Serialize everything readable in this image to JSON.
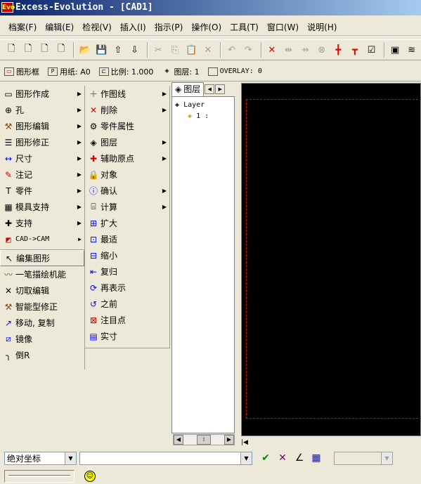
{
  "title": "Excess-Evolution - [CAD1]",
  "app_icon": "Evo",
  "menus": [
    "档案(F)",
    "编辑(E)",
    "检视(V)",
    "插入(I)",
    "指示(P)",
    "操作(O)",
    "工具(T)",
    "窗口(W)",
    "说明(H)"
  ],
  "status": {
    "frame": "图形框",
    "paper": "用纸: A0",
    "scale": "比例: 1.000",
    "layer": "图层: 1",
    "overlay": "OVERLAY: 0"
  },
  "left_menu": [
    {
      "label": "图形作成",
      "icon": "shape-icon",
      "arrow": true
    },
    {
      "label": "孔",
      "icon": "hole-icon",
      "arrow": true
    },
    {
      "label": "图形编辑",
      "icon": "hammer-icon",
      "arrow": true
    },
    {
      "label": "图形修正",
      "icon": "lines-icon",
      "arrow": true
    },
    {
      "label": "尺寸",
      "icon": "dimension-icon",
      "arrow": true
    },
    {
      "label": "注记",
      "icon": "annotation-icon",
      "arrow": true
    },
    {
      "label": "零件",
      "icon": "part-icon",
      "arrow": true
    },
    {
      "label": "模具支持",
      "icon": "mold-icon",
      "arrow": true
    },
    {
      "label": "支持",
      "icon": "cross-icon",
      "arrow": true
    },
    {
      "label": "CAD->CAM",
      "icon": "cam-icon",
      "arrow": true
    },
    {
      "label": "编集图形",
      "icon": "cursor-icon",
      "arrow": false
    },
    {
      "label": "一笔描绘机能",
      "icon": "stroke-icon",
      "arrow": false
    },
    {
      "label": "切取编辑",
      "icon": "cut-icon",
      "arrow": false
    },
    {
      "label": "智能型修正",
      "icon": "hammer-icon",
      "arrow": false
    },
    {
      "label": "移动, 复制",
      "icon": "move-icon",
      "arrow": false
    },
    {
      "label": "镜像",
      "icon": "mirror-icon",
      "arrow": false
    },
    {
      "label": "倒R",
      "icon": "fillet-icon",
      "arrow": false
    }
  ],
  "mid_menu": [
    {
      "label": "作图线",
      "icon": "plus-icon",
      "arrow": true
    },
    {
      "label": "削除",
      "icon": "delete-icon",
      "arrow": true
    },
    {
      "label": "零件属性",
      "icon": "part-attr-icon",
      "arrow": false
    },
    {
      "label": "图层",
      "icon": "layer-icon",
      "arrow": true
    },
    {
      "label": "辅助原点",
      "icon": "origin-icon",
      "arrow": true
    },
    {
      "label": "对象",
      "icon": "lock-icon",
      "arrow": false
    },
    {
      "label": "确认",
      "icon": "info-icon",
      "arrow": true
    },
    {
      "label": "计算",
      "icon": "calc-icon",
      "arrow": true
    },
    {
      "label": "扩大",
      "icon": "zoom-in-icon",
      "arrow": false
    },
    {
      "label": "最适",
      "icon": "fit-icon",
      "arrow": false
    },
    {
      "label": "缩小",
      "icon": "zoom-out-icon",
      "arrow": false
    },
    {
      "label": "复归",
      "icon": "return-icon",
      "arrow": false
    },
    {
      "label": "再表示",
      "icon": "redraw-icon",
      "arrow": false
    },
    {
      "label": "之前",
      "icon": "previous-icon",
      "arrow": false
    },
    {
      "label": "注目点",
      "icon": "focus-icon",
      "arrow": false
    },
    {
      "label": "实寸",
      "icon": "actual-size-icon",
      "arrow": false
    }
  ],
  "layer_panel": {
    "tab": "图层",
    "root": "Layer",
    "child": "1 :"
  },
  "command": {
    "coord_mode": "绝对坐标",
    "input": ""
  },
  "colors": {
    "canvas": "#000000",
    "frame": "#e00000",
    "titlebar": "#0a246a"
  }
}
